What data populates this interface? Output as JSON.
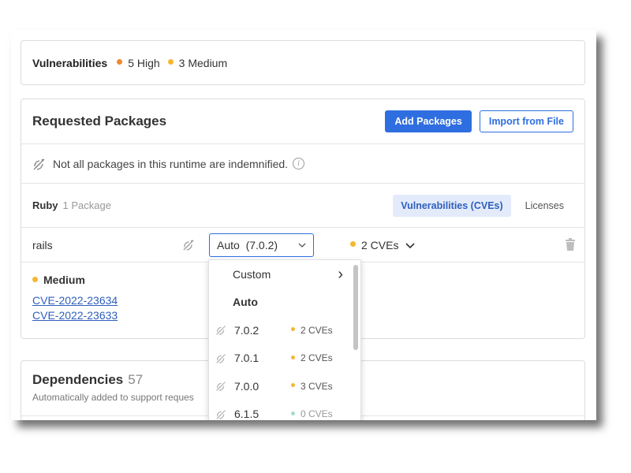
{
  "vulnerabilities": {
    "label": "Vulnerabilities",
    "high": "5 High",
    "medium": "3 Medium",
    "high_color": "#f0892d",
    "medium_color": "#f5b731"
  },
  "requested": {
    "title": "Requested Packages",
    "add_button": "Add Packages",
    "import_button": "Import from File",
    "notice": "Not all packages in this runtime are indemnified.",
    "info_glyph": "i",
    "language": "Ruby",
    "language_count": "1 Package",
    "tab_vulnerabilities": "Vulnerabilities (CVEs)",
    "tab_licenses": "Licenses"
  },
  "package": {
    "name": "rails",
    "version_value": "Auto  (7.0.2)",
    "cve_summary": "2 CVEs",
    "detail_severity": "Medium",
    "cves": [
      "CVE-2022-23634",
      "CVE-2022-23633"
    ]
  },
  "dependencies": {
    "title": "Dependencies",
    "count": "57",
    "subtitle": "Automatically added to support reques"
  },
  "dropdown": {
    "custom_label": "Custom",
    "custom_chevron": "›",
    "auto_label": "Auto",
    "versions": [
      {
        "version": "7.0.2",
        "cves": "2 CVEs"
      },
      {
        "version": "7.0.1",
        "cves": "2 CVEs"
      },
      {
        "version": "7.0.0",
        "cves": "3 CVEs"
      },
      {
        "version": "6.1.5",
        "cves": "0 CVEs"
      }
    ]
  },
  "colors": {
    "accent": "#2f6ee0",
    "medium": "#f5b731",
    "none": "#a8dcc4"
  },
  "icons": {
    "indemnity": "satellite-dish-slash-icon",
    "chevron": "chevron-down-icon",
    "trash": "trash-icon"
  }
}
